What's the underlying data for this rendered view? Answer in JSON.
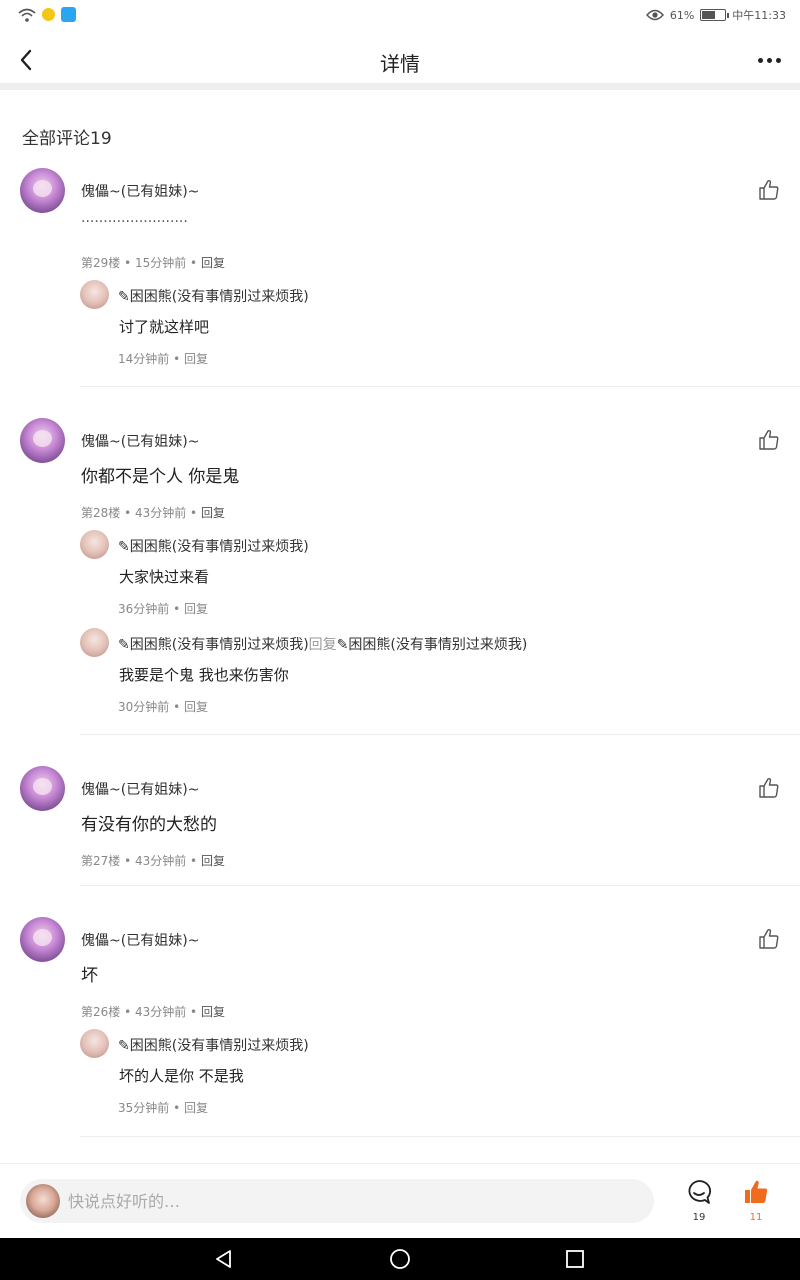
{
  "status_bar": {
    "battery_text": "61%",
    "battery_level": 0.61,
    "time": "中午11:33",
    "icons": [
      "wifi-icon",
      "app-notification-icon",
      "app-notification-icon",
      "eye-icon",
      "battery-icon"
    ]
  },
  "header": {
    "title": "详情"
  },
  "comments_heading": "全部评论19",
  "comments": [
    {
      "author": "傀儡~(已有姐妹)~",
      "content": "························",
      "meta": "第29楼 • 15分钟前 • ",
      "reply_label": "回复",
      "replies": [
        {
          "author": "✎困困熊(没有事情别过来烦我)",
          "reply_to": "",
          "content": "讨了就这样吧",
          "meta": "14分钟前 • ",
          "reply_label": "回复"
        }
      ]
    },
    {
      "author": "傀儡~(已有姐妹)~",
      "content": "你都不是个人 你是鬼",
      "meta": "第28楼 • 43分钟前 • ",
      "reply_label": "回复",
      "replies": [
        {
          "author": "✎困困熊(没有事情别过来烦我)",
          "reply_to": "",
          "content": "大家快过来看",
          "meta": "36分钟前 • ",
          "reply_label": "回复"
        },
        {
          "author": "✎困困熊(没有事情别过来烦我)",
          "reply_to_label": "回复",
          "reply_to": "✎困困熊(没有事情别过来烦我)",
          "content": "我要是个鬼 我也来伤害你",
          "meta": "30分钟前 • ",
          "reply_label": "回复"
        }
      ]
    },
    {
      "author": "傀儡~(已有姐妹)~",
      "content": "有没有你的大愁的",
      "meta": "第27楼 • 43分钟前 • ",
      "reply_label": "回复",
      "replies": []
    },
    {
      "author": "傀儡~(已有姐妹)~",
      "content": "坏",
      "meta": "第26楼 • 43分钟前 • ",
      "reply_label": "回复",
      "replies": [
        {
          "author": "✎困困熊(没有事情别过来烦我)",
          "reply_to": "",
          "content": "坏的人是你 不是我",
          "meta": "35分钟前 • ",
          "reply_label": "回复"
        }
      ]
    }
  ],
  "bottom_bar": {
    "input_placeholder": "快说点好听的…",
    "comment_count": "19",
    "like_count": "11"
  },
  "colors": {
    "accent": "#f26b1d",
    "text": "#222222",
    "meta": "#888888"
  }
}
